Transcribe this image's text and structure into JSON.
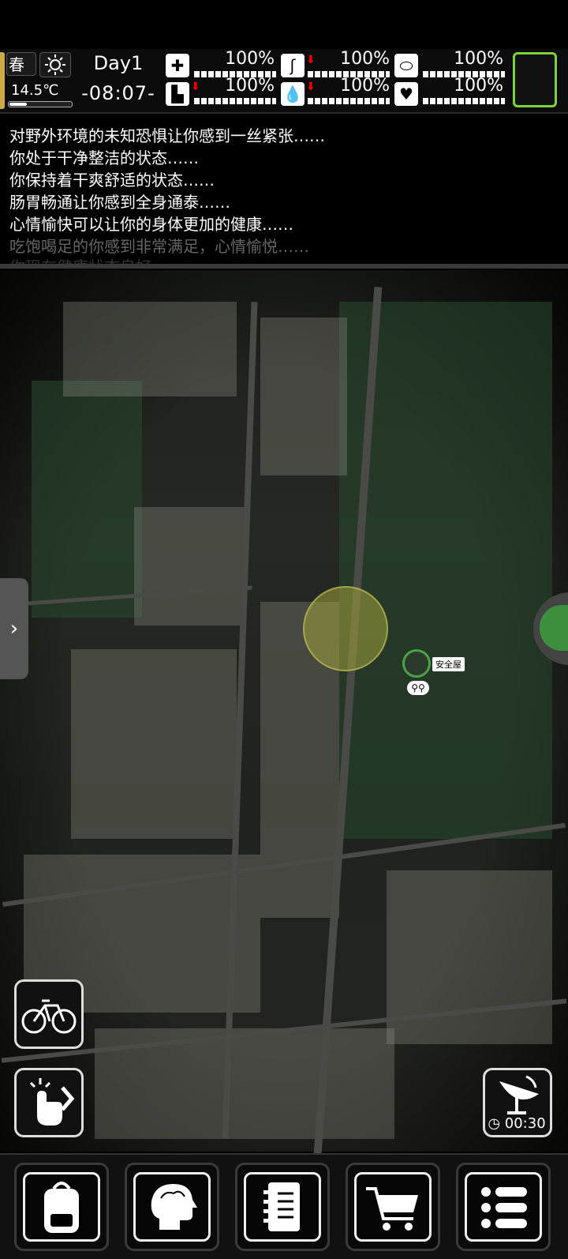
{
  "hud": {
    "season": "春",
    "temperature": "14.5℃",
    "day": "Day1",
    "time": "-08:07-",
    "stats": [
      {
        "name": "health",
        "icon": "medkit-icon",
        "value": "100%",
        "falling": false
      },
      {
        "name": "stomach",
        "icon": "stomach-icon",
        "value": "100%",
        "falling": true
      },
      {
        "name": "hygiene",
        "icon": "soap-icon",
        "value": "100%",
        "falling": false
      },
      {
        "name": "stamina",
        "icon": "boot-icon",
        "value": "100%",
        "falling": true
      },
      {
        "name": "thirst",
        "icon": "water-drop-icon",
        "value": "100%",
        "falling": true
      },
      {
        "name": "mood",
        "icon": "heart-icon",
        "value": "100%",
        "falling": false
      }
    ]
  },
  "log": {
    "lines": [
      "对野外环境的未知恐惧让你感到一丝紧张……",
      "你处于干净整洁的状态……",
      "你保持着干爽舒适的状态……",
      "肠胃畅通让你感到全身通泰……",
      "心情愉快可以让你的身体更加的健康……",
      "吃饱喝足的你感到非常满足，心情愉悦……",
      "你现在健康状态良好"
    ]
  },
  "map": {
    "player_label": "安全屋",
    "radio_timer": "00:30"
  },
  "colors": {
    "accent_green": "#7bd23b",
    "stat_down_arrow": "#e00000"
  }
}
